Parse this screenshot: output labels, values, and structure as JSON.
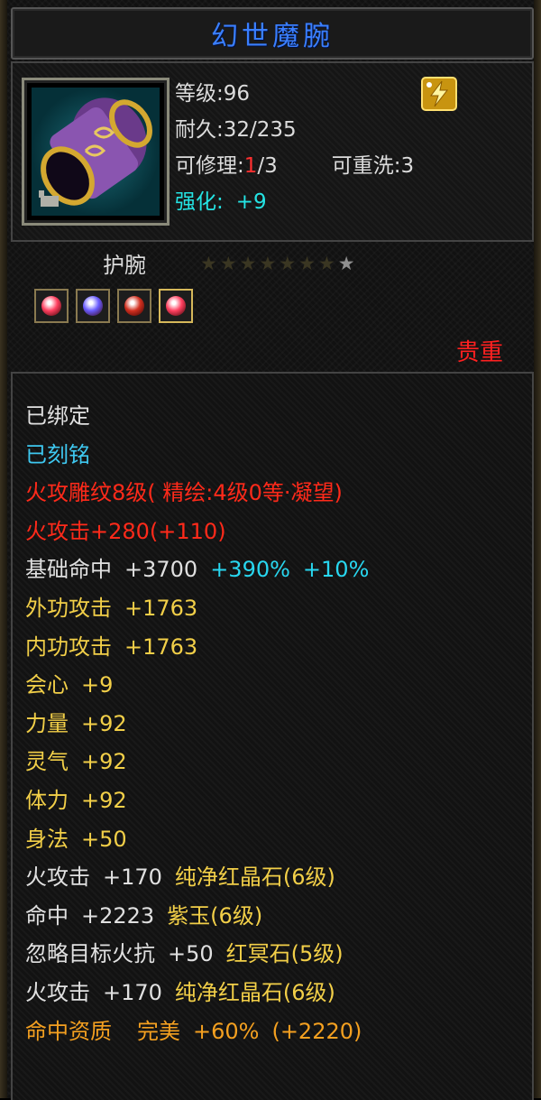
{
  "item": {
    "name": "幻世魔腕",
    "level": "等级:96",
    "durability": "耐久:32/235",
    "repair_prefix": "可修理:",
    "repair_current": "1",
    "repair_suffix": "/3",
    "rewash": "可重洗:3",
    "enhance_label": "强化:",
    "enhance_value": "+9",
    "type": "护腕",
    "stars_total": 8,
    "stars_lit": 1,
    "quality": "贵重"
  },
  "gems": [
    {
      "icon": "red-gem-icon",
      "color": "#ff4060"
    },
    {
      "icon": "purple-gem-icon",
      "color": "#6a5cff"
    },
    {
      "icon": "red-crystal-icon",
      "color": "#d23020"
    },
    {
      "icon": "red-gem-icon",
      "color": "#ff4060"
    }
  ],
  "attributes": {
    "bound": "已绑定",
    "engraved": "已刻铭",
    "carve": "火攻雕纹8级( 精绘:4级0等·凝望)",
    "fire_attack": "火攻击+280(+110)",
    "base_hit_label": "基础命中",
    "base_hit_value": "+3700",
    "base_hit_bonus1": "+390%",
    "base_hit_bonus2": "+10%",
    "outer_attack_label": "外功攻击",
    "outer_attack_value": "+1763",
    "inner_attack_label": "内功攻击",
    "inner_attack_value": "+1763",
    "crit_label": "会心",
    "crit_value": "+9",
    "strength_label": "力量",
    "strength_value": "+92",
    "spirit_label": "灵气",
    "spirit_value": "+92",
    "stamina_label": "体力",
    "stamina_value": "+92",
    "agility_label": "身法",
    "agility_value": "+50",
    "gem1_label": "火攻击",
    "gem1_value": "+170",
    "gem1_name": "纯净红晶石(6级)",
    "gem2_label": "命中",
    "gem2_value": "+2223",
    "gem2_name": "紫玉(6级)",
    "gem3_label": "忽略目标火抗",
    "gem3_value": "+50",
    "gem3_name": "红冥石(5级)",
    "gem4_label": "火攻击",
    "gem4_value": "+170",
    "gem4_name": "纯净红晶石(6级)",
    "aptitude_label": "命中资质",
    "aptitude_grade": "完美",
    "aptitude_value": "+60%",
    "aptitude_bonus": "(+2220)"
  },
  "colors": {
    "title": "#3a7fff",
    "quality": "#ff2020",
    "enhance": "#24e3e3"
  }
}
